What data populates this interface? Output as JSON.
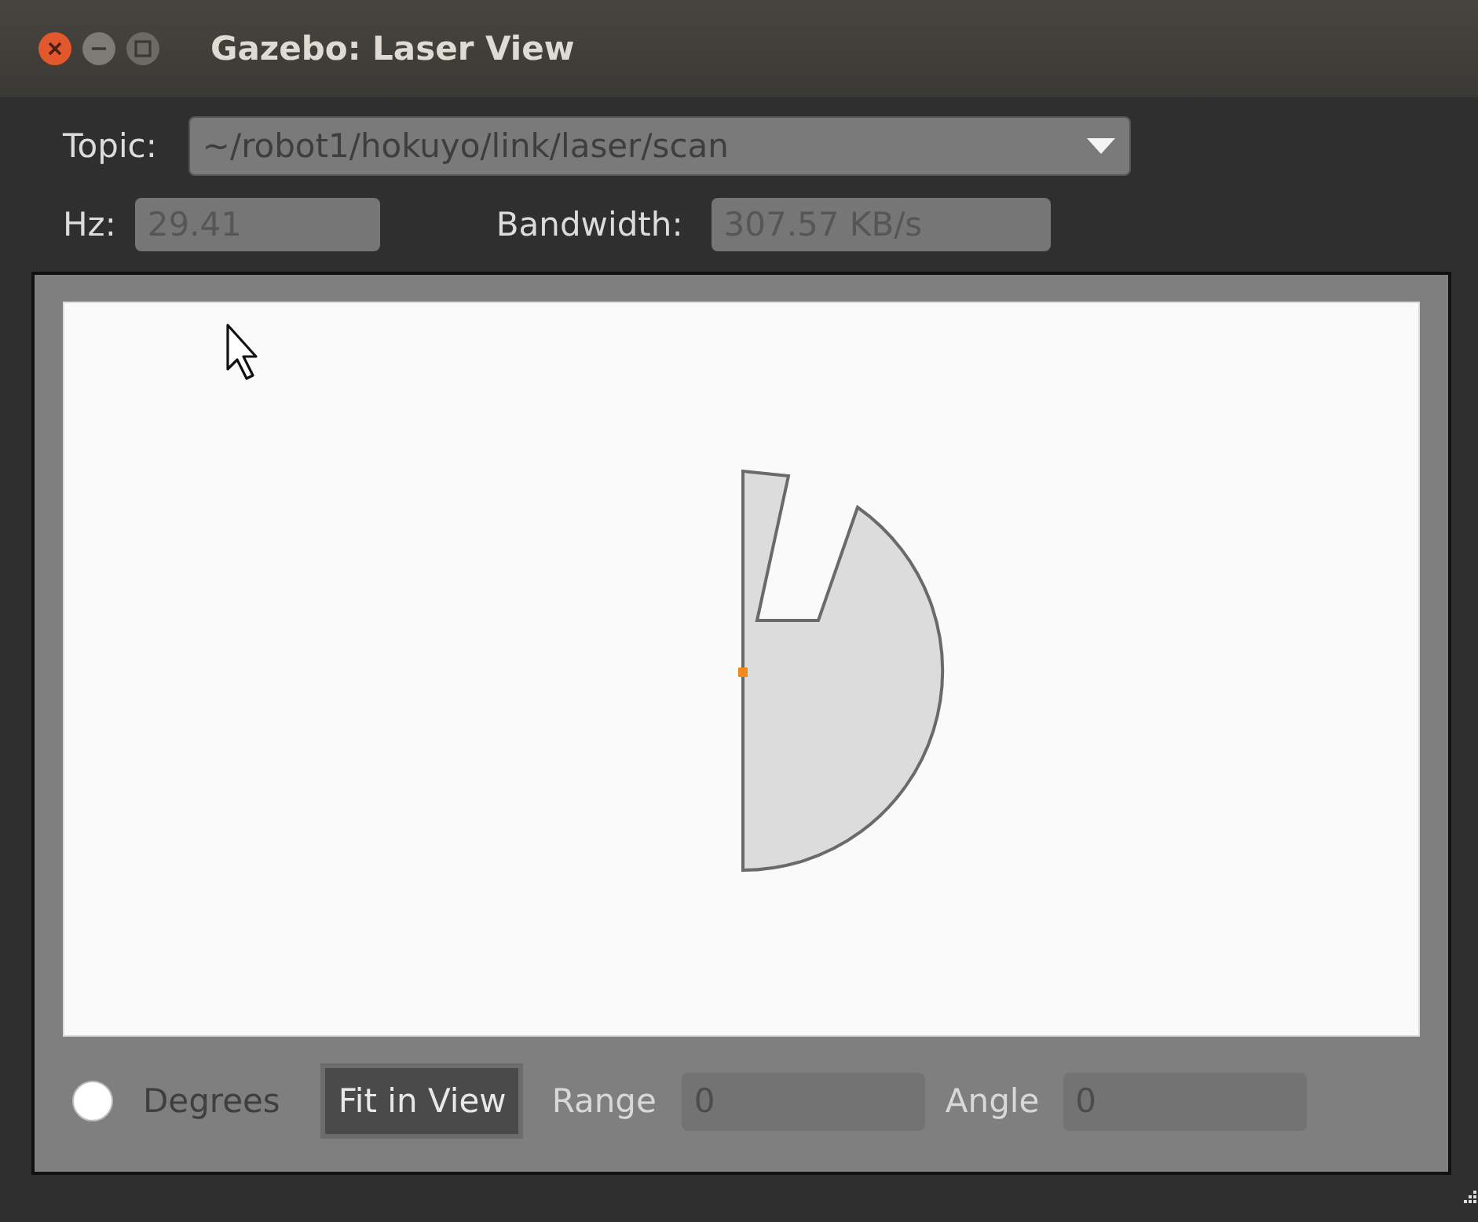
{
  "window": {
    "title": "Gazebo: Laser View"
  },
  "topic": {
    "label": "Topic:",
    "value": "~/robot1/hokuyo/link/laser/scan"
  },
  "hz": {
    "label": "Hz:",
    "value": "29.41"
  },
  "bandwidth": {
    "label": "Bandwidth:",
    "value": "307.57 KB/s"
  },
  "controls": {
    "degrees": {
      "label": "Degrees",
      "checked": false,
      "disabled": true
    },
    "fit_button": "Fit in View",
    "range": {
      "label": "Range",
      "value": "0"
    },
    "angle": {
      "label": "Angle",
      "value": "0"
    }
  }
}
